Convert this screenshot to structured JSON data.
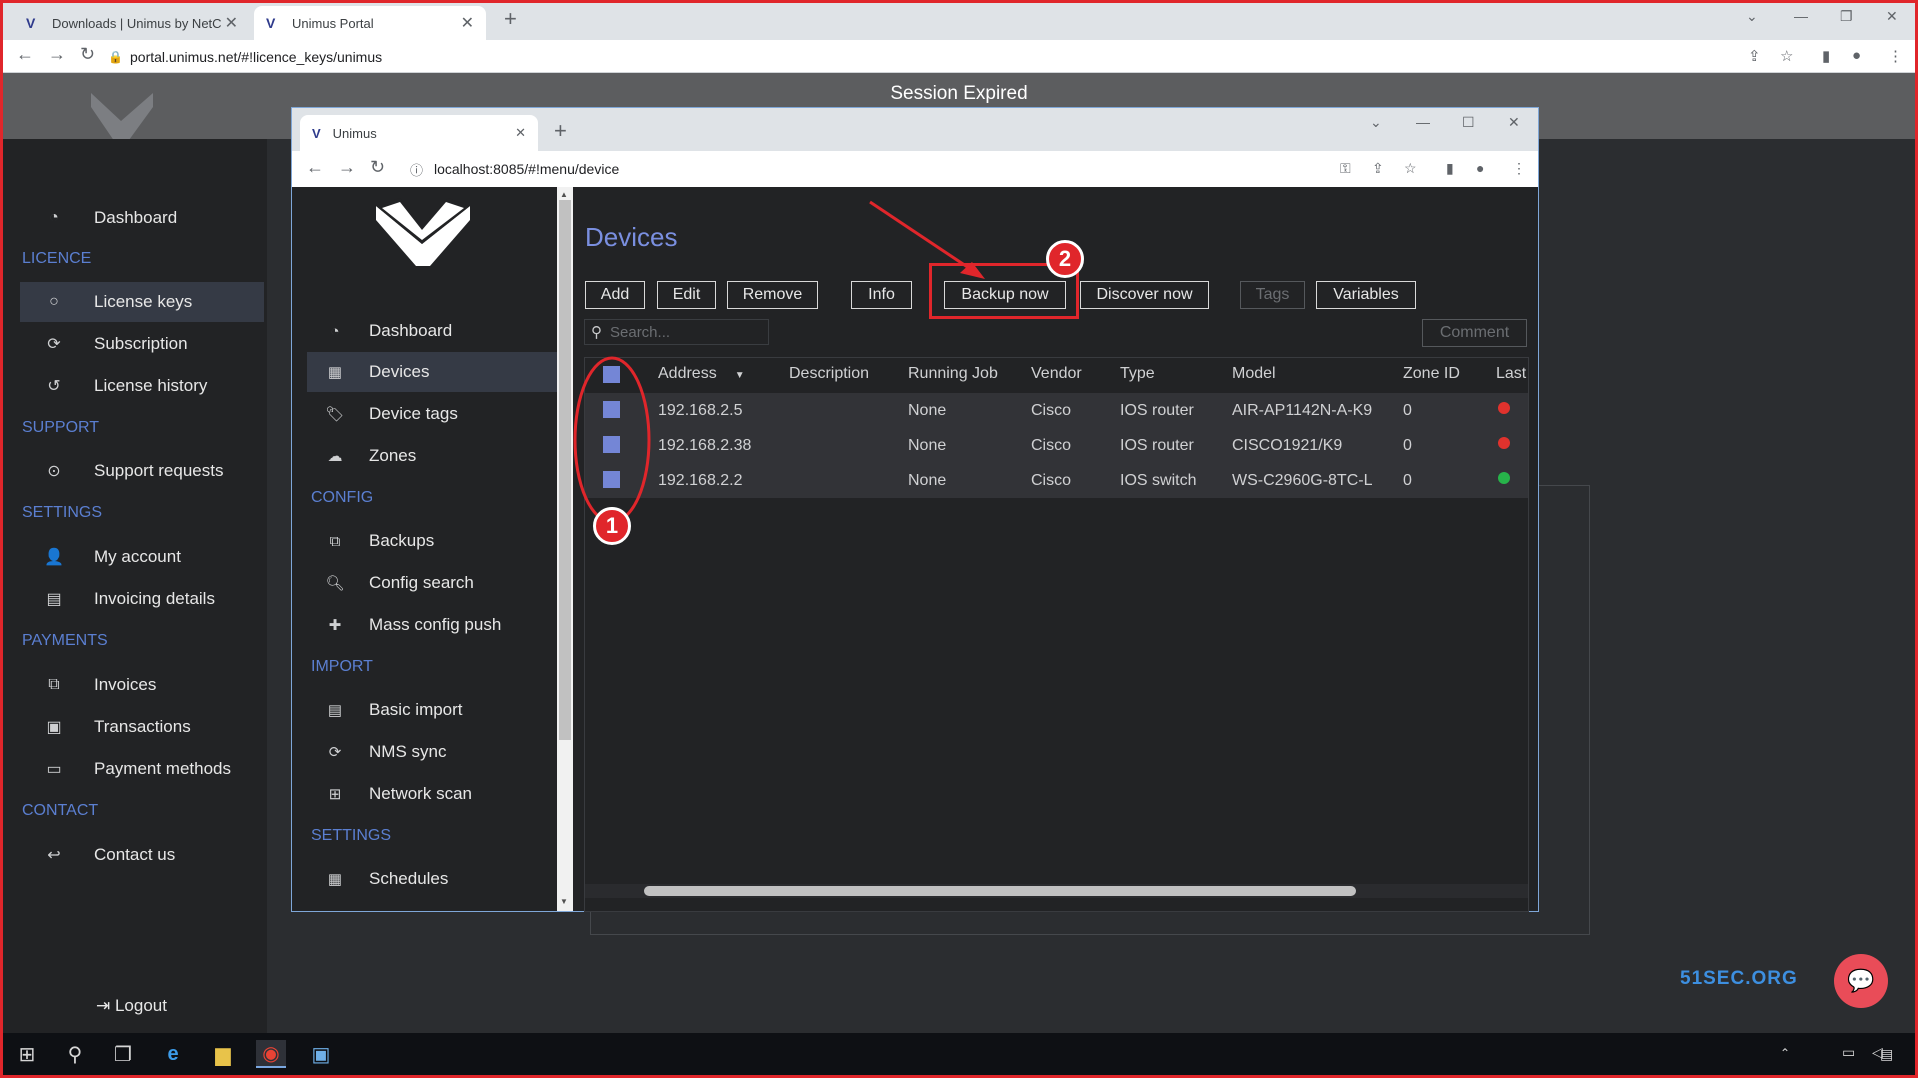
{
  "outer_browser": {
    "tabs": [
      {
        "label": "Downloads | Unimus by NetCore"
      },
      {
        "label": "Unimus Portal"
      }
    ],
    "url": "portal.unimus.net/#!licence_keys/unimus"
  },
  "portal": {
    "session_text": "Session Expired",
    "menu": {
      "dashboard": "Dashboard",
      "licence_section": "LICENCE",
      "license_keys": "License keys",
      "subscription": "Subscription",
      "license_history": "License history",
      "support_section": "SUPPORT",
      "support_requests": "Support requests",
      "settings_section": "SETTINGS",
      "my_account": "My account",
      "invoicing_details": "Invoicing details",
      "payments_section": "PAYMENTS",
      "invoices": "Invoices",
      "transactions": "Transactions",
      "payment_methods": "Payment methods",
      "contact_section": "CONTACT",
      "contact_us": "Contact us"
    },
    "logout": "Logout",
    "watermark": "51SEC.ORG"
  },
  "inner_browser": {
    "tab_label": "Unimus",
    "url": "localhost:8085/#!menu/device"
  },
  "unimus": {
    "menu": {
      "dashboard": "Dashboard",
      "devices": "Devices",
      "device_tags": "Device tags",
      "zones": "Zones",
      "config_section": "CONFIG",
      "backups": "Backups",
      "config_search": "Config search",
      "mass_config_push": "Mass config push",
      "import_section": "IMPORT",
      "basic_import": "Basic import",
      "nms_sync": "NMS sync",
      "network_scan": "Network scan",
      "settings_section": "SETTINGS",
      "schedules": "Schedules"
    },
    "page_title": "Devices",
    "toolbar": {
      "add": "Add",
      "edit": "Edit",
      "remove": "Remove",
      "info": "Info",
      "backup_now": "Backup now",
      "discover_now": "Discover now",
      "tags": "Tags",
      "variables": "Variables",
      "comment": "Comment"
    },
    "search_placeholder": "Search...",
    "table": {
      "columns": [
        "Address",
        "Description",
        "Running Job",
        "Vendor",
        "Type",
        "Model",
        "Zone ID",
        "Last"
      ],
      "rows": [
        {
          "address": "192.168.2.5",
          "description": "",
          "running_job": "None",
          "vendor": "Cisco",
          "type": "IOS router",
          "model": "AIR-AP1142N-A-K9",
          "zone_id": "0",
          "status_color": "#e0322d"
        },
        {
          "address": "192.168.2.38",
          "description": "",
          "running_job": "None",
          "vendor": "Cisco",
          "type": "IOS router",
          "model": "CISCO1921/K9",
          "zone_id": "0",
          "status_color": "#e0322d"
        },
        {
          "address": "192.168.2.2",
          "description": "",
          "running_job": "None",
          "vendor": "Cisco",
          "type": "IOS switch",
          "model": "WS-C2960G-8TC-L",
          "zone_id": "0",
          "status_color": "#27b34a"
        }
      ]
    }
  },
  "annotations": {
    "badge_1": "1",
    "badge_2": "2",
    "color": "#e0262b"
  }
}
